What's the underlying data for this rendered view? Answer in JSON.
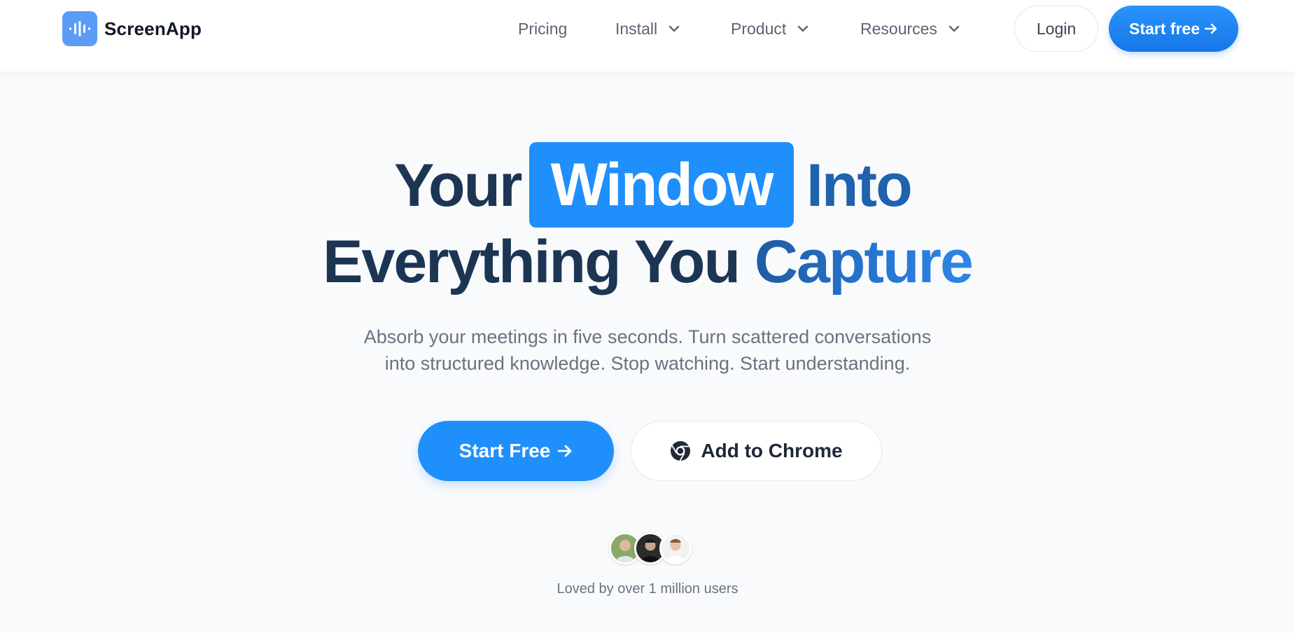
{
  "brand": {
    "name": "ScreenApp",
    "logo_color": "#5a9cf6"
  },
  "nav": {
    "items": [
      {
        "label": "Pricing",
        "has_dropdown": false
      },
      {
        "label": "Install",
        "has_dropdown": true
      },
      {
        "label": "Product",
        "has_dropdown": true
      },
      {
        "label": "Resources",
        "has_dropdown": true
      }
    ],
    "login_label": "Login",
    "start_label": "Start free"
  },
  "hero": {
    "headline_word1": "Your",
    "headline_highlight": "Window",
    "headline_word3": "Into",
    "headline_line2_a": "Everything You",
    "headline_line2_b": "Capture",
    "subtitle_line1": "Absorb your meetings in five seconds. Turn scattered conversations",
    "subtitle_line2": "into structured knowledge. Stop watching. Start understanding.",
    "primary_cta": "Start Free",
    "secondary_cta": "Add to Chrome",
    "social_proof": "Loved by over 1 million users",
    "avatars": [
      "avatar-user-1",
      "avatar-user-2",
      "avatar-user-3"
    ]
  },
  "colors": {
    "accent": "#1f8ffb",
    "headline_dark": "#1c3553",
    "headline_blue": "#1f62ad",
    "text_muted": "#6a7280"
  }
}
